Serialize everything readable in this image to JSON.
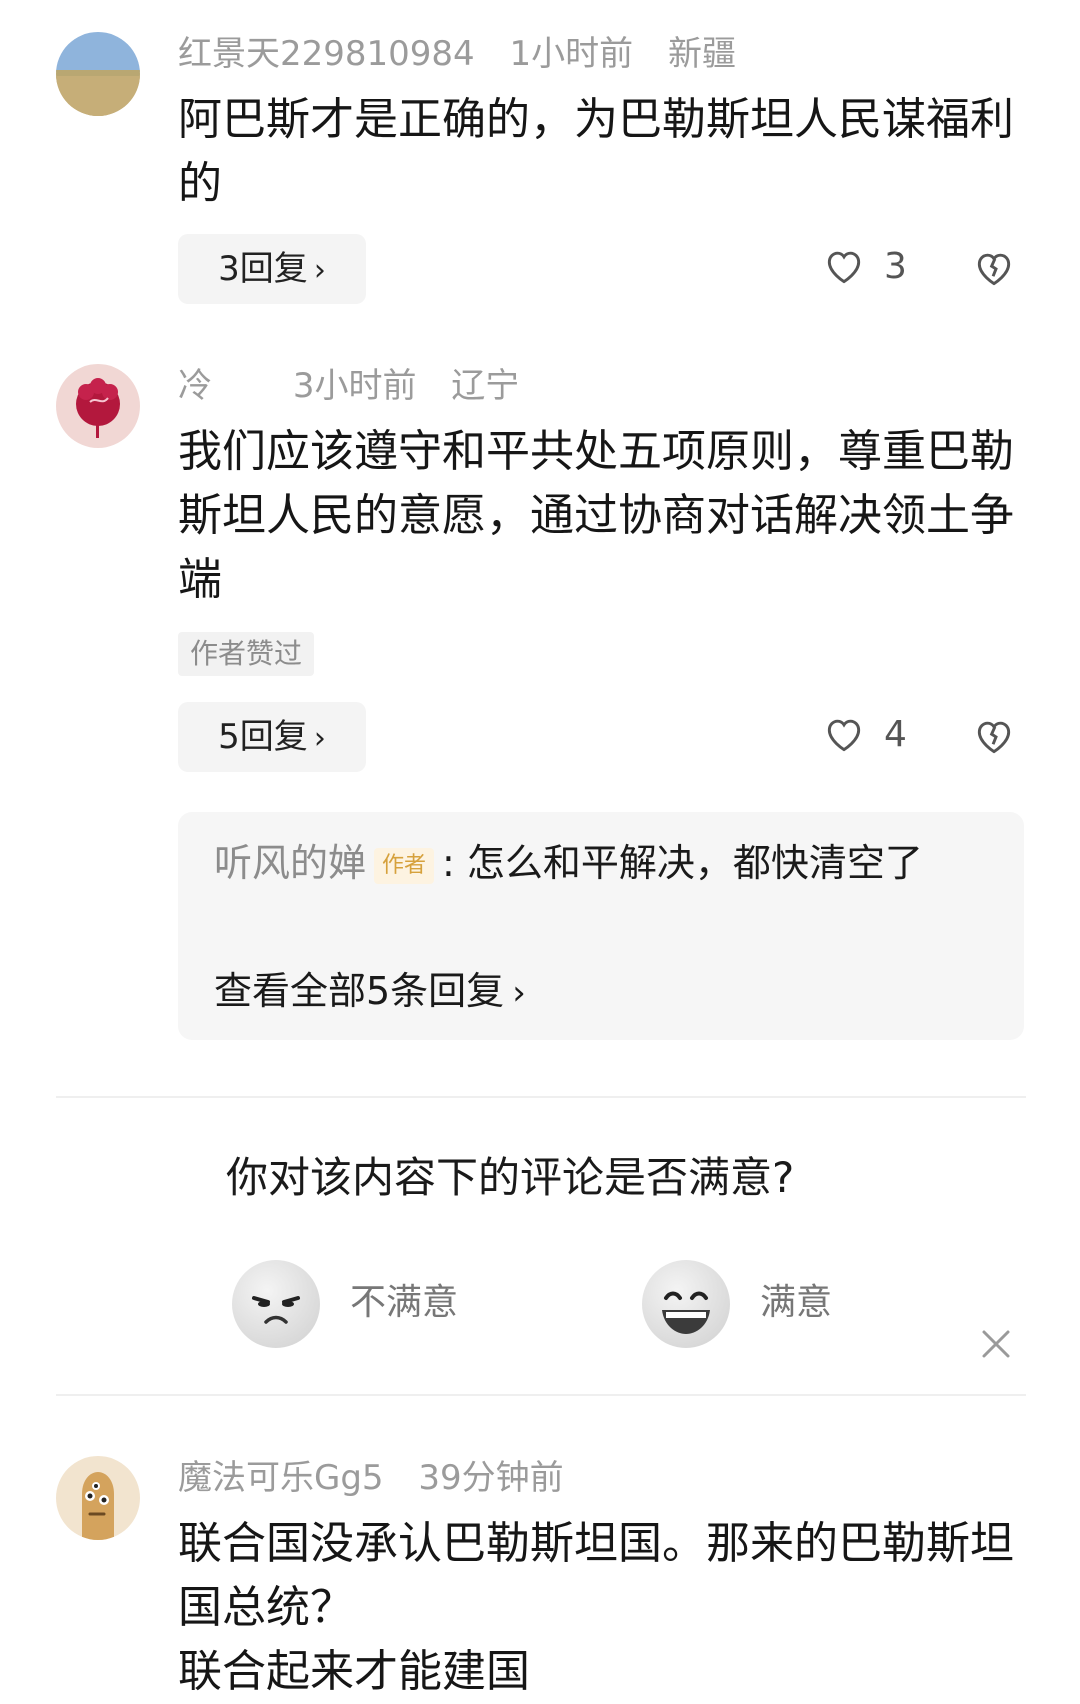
{
  "comments": [
    {
      "username": "红景天229810984",
      "time": "1小时前",
      "location": "新疆",
      "text": "阿巴斯才是正确的，为巴勒斯坦人民谋福利的",
      "reply_label": "3回复",
      "likes": "3"
    },
    {
      "username": "冷",
      "time": "3小时前",
      "location": "辽宁",
      "text": "我们应该遵守和平共处五项原则，尊重巴勒斯坦人民的意愿，通过协商对话解决领土争端",
      "tag": "作者赞过",
      "reply_label": "5回复",
      "likes": "4",
      "sub_reply": {
        "author": "听风的婵",
        "badge": "作者",
        "text": ": 怎么和平解决，都快清空了",
        "view_all": "查看全部5条回复"
      }
    },
    {
      "username": "魔法可乐Gg5",
      "time": "39分钟前",
      "text_line1": "联合国没承认巴勒斯坦国。那来的巴勒斯坦国总统？",
      "text_line2": "联合起来才能建国"
    }
  ],
  "survey": {
    "question": "你对该内容下的评论是否满意?",
    "option_unsatisfied": "不满意",
    "option_satisfied": "满意"
  },
  "icons": {
    "like": "heart-outline-icon",
    "dislike": "broken-heart-icon",
    "chevron": "chevron-right-icon",
    "close": "close-icon"
  }
}
